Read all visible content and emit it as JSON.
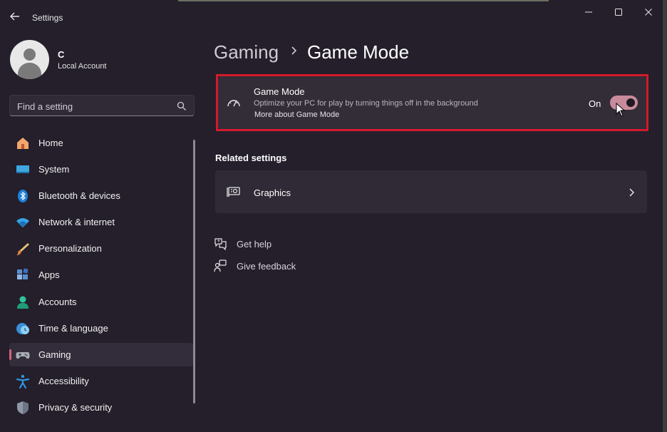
{
  "window": {
    "title": "Settings"
  },
  "profile": {
    "name": "C",
    "account_type": "Local Account"
  },
  "search": {
    "placeholder": "Find a setting"
  },
  "sidebar": {
    "items": [
      {
        "label": "Home",
        "icon": "home-icon"
      },
      {
        "label": "System",
        "icon": "system-icon"
      },
      {
        "label": "Bluetooth & devices",
        "icon": "bluetooth-icon"
      },
      {
        "label": "Network & internet",
        "icon": "network-icon"
      },
      {
        "label": "Personalization",
        "icon": "personalization-icon"
      },
      {
        "label": "Apps",
        "icon": "apps-icon"
      },
      {
        "label": "Accounts",
        "icon": "accounts-icon"
      },
      {
        "label": "Time & language",
        "icon": "time-language-icon"
      },
      {
        "label": "Gaming",
        "icon": "gaming-icon",
        "active": true
      },
      {
        "label": "Accessibility",
        "icon": "accessibility-icon"
      },
      {
        "label": "Privacy & security",
        "icon": "privacy-icon"
      }
    ]
  },
  "breadcrumb": {
    "parent": "Gaming",
    "current": "Game Mode"
  },
  "game_mode": {
    "title": "Game Mode",
    "description": "Optimize your PC for play by turning things off in the background",
    "link": "More about Game Mode",
    "state_label": "On",
    "enabled": true
  },
  "related": {
    "heading": "Related settings",
    "items": [
      {
        "label": "Graphics"
      }
    ]
  },
  "help": {
    "get_help": "Get help",
    "give_feedback": "Give feedback"
  },
  "colors": {
    "accent": "#d3637d",
    "toggle_on": "#c98b9b",
    "highlight_box": "#d41a2b",
    "background": "#241f2b"
  }
}
